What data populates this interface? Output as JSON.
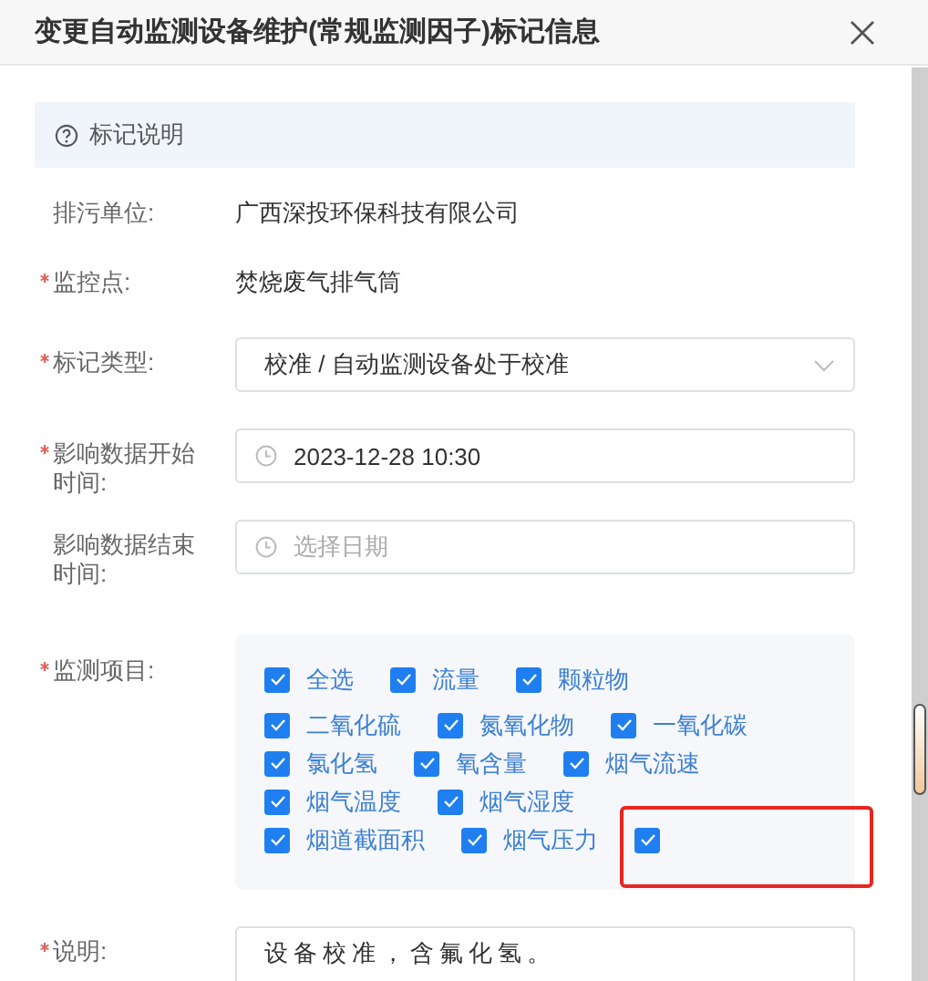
{
  "dialog": {
    "title": "变更自动监测设备维护(常规监测因子)标记信息"
  },
  "notice": {
    "text": "标记说明"
  },
  "form_rows": [
    {
      "kind": "text",
      "label": "排污单位:",
      "required": false,
      "value": "广西深投环保科技有限公司"
    },
    {
      "kind": "text",
      "label": "监控点:",
      "required": true,
      "value": "焚烧废气排气筒"
    },
    {
      "kind": "select",
      "label": "标记类型:",
      "required": true,
      "value": "校准 / 自动监测设备处于校准"
    },
    {
      "kind": "date",
      "label": "影响数据开始时间:",
      "required": true,
      "value": "2023-12-28 10:30"
    },
    {
      "kind": "date",
      "label": "影响数据结束时间:",
      "required": false,
      "placeholder": "选择日期"
    },
    {
      "kind": "checks",
      "label": "监测项目:",
      "required": true,
      "rows": [
        [
          {
            "label": "全选",
            "checked": true,
            "highlighted": false
          },
          {
            "label": "流量",
            "checked": true,
            "highlighted": false
          },
          {
            "label": "颗粒物",
            "checked": true,
            "highlighted": false
          }
        ],
        [
          {
            "label": "二氧化硫",
            "checked": true,
            "highlighted": false
          },
          {
            "label": "氮氧化物",
            "checked": true,
            "highlighted": false
          },
          {
            "label": "一氧化碳",
            "checked": true,
            "highlighted": false
          }
        ],
        [
          {
            "label": "氯化氢",
            "checked": true,
            "highlighted": false
          },
          {
            "label": "氧含量",
            "checked": true,
            "highlighted": false
          },
          {
            "label": "烟气流速",
            "checked": true,
            "highlighted": false
          }
        ],
        [
          {
            "label": "烟气温度",
            "checked": true,
            "highlighted": false
          },
          {
            "label": "烟气湿度",
            "checked": true,
            "highlighted": false
          }
        ],
        [
          {
            "label": "烟道截面积",
            "checked": true,
            "highlighted": false
          },
          {
            "label": "烟气压力",
            "checked": true,
            "highlighted": false
          },
          {
            "checked": true,
            "highlighted": true
          }
        ]
      ]
    },
    {
      "kind": "textarea",
      "label": "说明:",
      "required": true,
      "value": "设备校准，含氟化氢。"
    }
  ]
}
